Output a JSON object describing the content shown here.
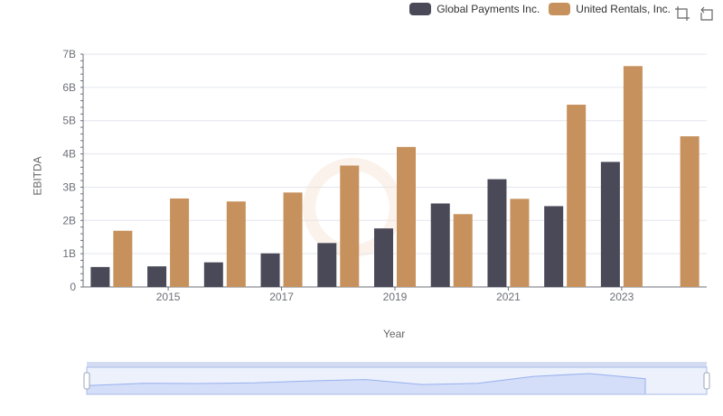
{
  "colors": {
    "global_payments": "#4a4958",
    "united_rentals": "#c6915c",
    "grid": "#e4e6ee",
    "axis": "#6e7079",
    "zoom_fill": "#dfe6fb",
    "zoom_line": "#8fa9ea"
  },
  "toolbox": {
    "icons": [
      "zoom-icon",
      "restore-icon"
    ]
  },
  "chart_data": {
    "type": "bar",
    "xlabel": "Year",
    "ylabel": "EBITDA",
    "ylim": [
      0,
      7000000000
    ],
    "y_ticks": [
      "0",
      "1B",
      "2B",
      "3B",
      "4B",
      "5B",
      "6B",
      "7B"
    ],
    "categories": [
      "2014",
      "2015",
      "2016",
      "2017",
      "2018",
      "2019",
      "2020",
      "2021",
      "2022",
      "2023",
      "2024"
    ],
    "x_tick_labels": [
      "2015",
      "2017",
      "2019",
      "2021",
      "2023"
    ],
    "legend_position": "top-right",
    "grid": true,
    "series": [
      {
        "name": "Global Payments Inc.",
        "color": "#4a4958",
        "values": [
          600000000,
          620000000,
          740000000,
          1010000000,
          1320000000,
          1760000000,
          2510000000,
          3240000000,
          2430000000,
          3760000000,
          null
        ]
      },
      {
        "name": "United Rentals, Inc.",
        "color": "#c6915c",
        "values": [
          1690000000,
          2660000000,
          2570000000,
          2840000000,
          3650000000,
          4210000000,
          2190000000,
          2650000000,
          5480000000,
          6640000000,
          4530000000
        ]
      }
    ]
  }
}
